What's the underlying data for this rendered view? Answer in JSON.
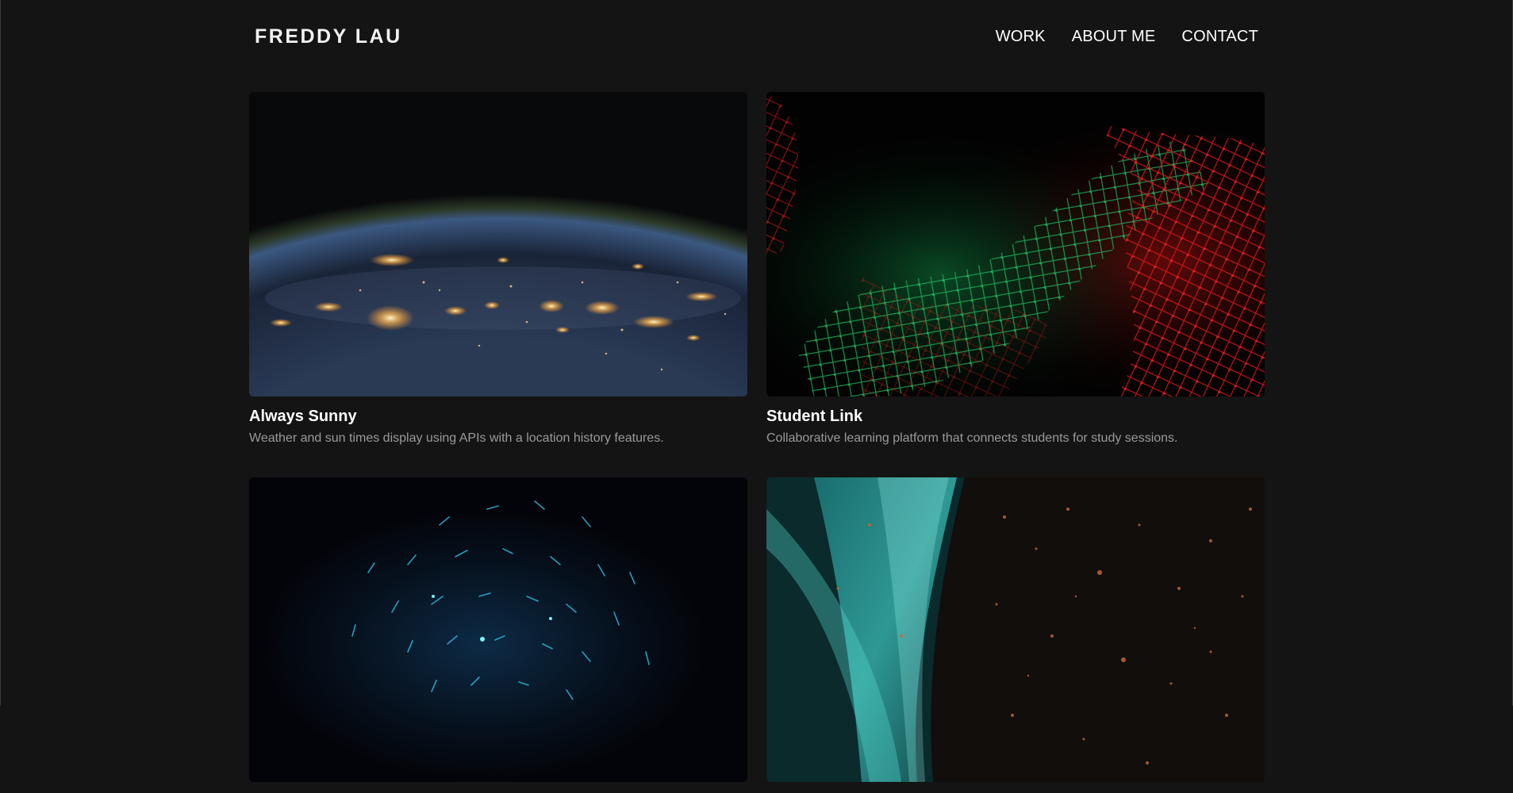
{
  "brand": {
    "name": "FREDDY LAU"
  },
  "nav": {
    "items": [
      {
        "label": "WORK"
      },
      {
        "label": "ABOUT ME"
      },
      {
        "label": "CONTACT"
      }
    ]
  },
  "projects": [
    {
      "title": "Always Sunny",
      "description": "Weather and sun times display using APIs with a location history features.",
      "image": "earth-at-night-image"
    },
    {
      "title": "Student Link",
      "description": "Collaborative learning platform that connects students for study sessions.",
      "image": "red-green-network-mesh-image"
    },
    {
      "title": "",
      "description": "",
      "image": "blue-particle-sphere-image"
    },
    {
      "title": "",
      "description": "",
      "image": "teal-copper-light-streaks-image"
    }
  ],
  "colors": {
    "background": "#141414",
    "text": "#ffffff",
    "muted": "#9a9a9a"
  }
}
